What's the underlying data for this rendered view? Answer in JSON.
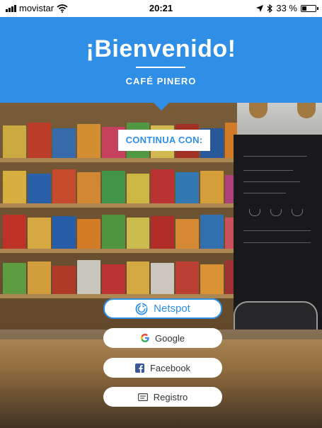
{
  "status_bar": {
    "carrier": "movistar",
    "time": "20:21",
    "battery": "33 %",
    "battery_level": 0.33,
    "icons": [
      "signal-icon",
      "wifi-icon",
      "location-arrow-icon",
      "bluetooth-icon",
      "battery-icon"
    ]
  },
  "header": {
    "title": "¡Bienvenido!",
    "subtitle": "CAFÉ PINERO",
    "background_color": "#2f8fe6"
  },
  "continue_label": "CONTINUA CON:",
  "login_buttons": {
    "netspot": {
      "label": "Netspot",
      "icon": "netspot-logo-icon",
      "color": "#2f8fe6"
    },
    "google": {
      "label": "Google",
      "icon": "google-logo-icon"
    },
    "facebook": {
      "label": "Facebook",
      "icon": "facebook-logo-icon",
      "color": "#3b5998"
    },
    "registro": {
      "label": "Registro",
      "icon": "form-card-icon"
    }
  }
}
